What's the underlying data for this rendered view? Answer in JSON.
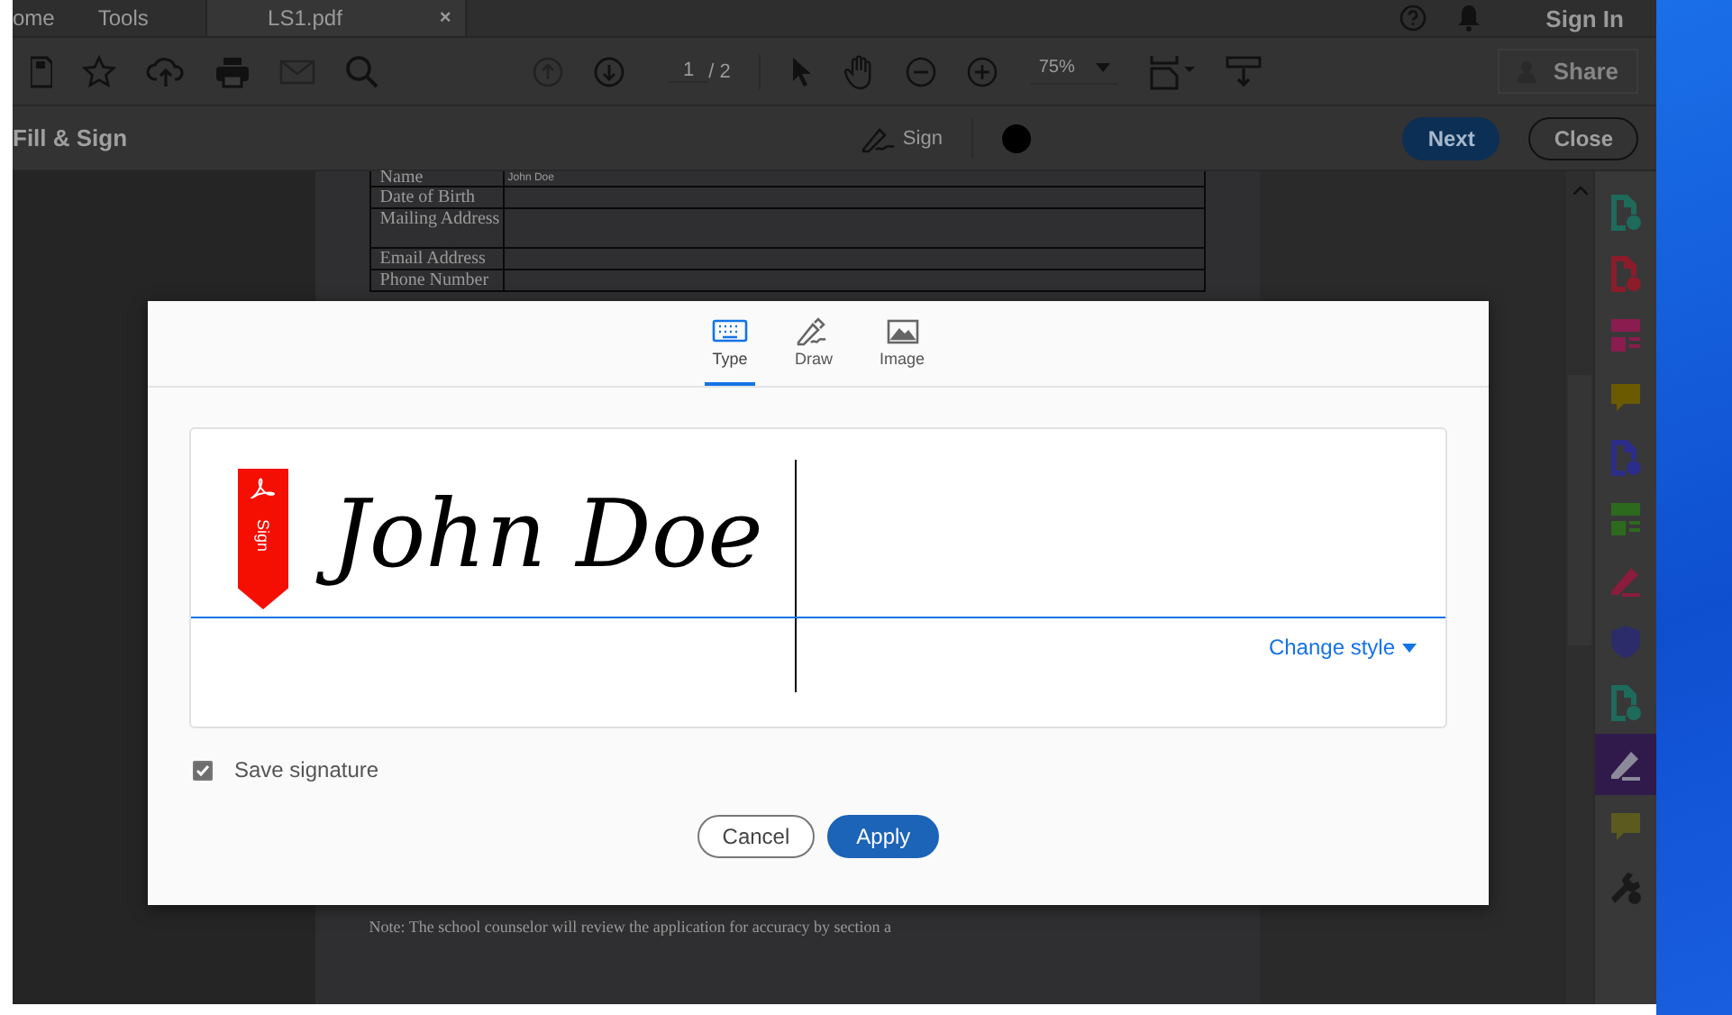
{
  "tabs": [
    {
      "label": "ome",
      "selected": false
    },
    {
      "label": "Tools",
      "selected": false
    },
    {
      "label": "LS1.pdf",
      "selected": true,
      "close": "×"
    }
  ],
  "header_right": {
    "sign_in": "Sign In"
  },
  "toolbar": {
    "page": "1",
    "page_total": "/ 2",
    "zoom": "75%",
    "share": "Share"
  },
  "fill_sign_bar": {
    "title": "Fill & Sign",
    "sign": "Sign",
    "next": "Next",
    "close": "Close"
  },
  "document": {
    "rows": [
      {
        "label": "Name",
        "value": "John Doe",
        "tall": false
      },
      {
        "label": "Date of Birth",
        "tall": false
      },
      {
        "label": "Mailing Address",
        "tall": true
      },
      {
        "label": "Email Address",
        "tall": false
      },
      {
        "label": "Phone Number",
        "tall": false
      }
    ],
    "note": "Note: The school counselor will review the application for accuracy by section a"
  },
  "tools_panel": [
    {
      "kind": "doc",
      "color": "#1e6b5c",
      "selected": false
    },
    {
      "kind": "doc",
      "color": "#8a1c2c",
      "selected": false
    },
    {
      "kind": "layout",
      "color": "#8a1c50",
      "selected": false
    },
    {
      "kind": "comment",
      "color": "#6b5a00",
      "selected": false
    },
    {
      "kind": "doc",
      "color": "#2c2c8a",
      "selected": false
    },
    {
      "kind": "layout",
      "color": "#2c6b1e",
      "selected": false
    },
    {
      "kind": "pen",
      "color": "#8a1c3c",
      "selected": false
    },
    {
      "kind": "shield",
      "color": "#2c2c6b",
      "selected": false
    },
    {
      "kind": "doc",
      "color": "#1e6b5c",
      "selected": false
    },
    {
      "kind": "pen",
      "color": "#8a8a9a",
      "selected": true
    },
    {
      "kind": "comment",
      "color": "#5c5a1e",
      "selected": false
    },
    {
      "kind": "wrench",
      "color": "#1a1a1a",
      "selected": false
    }
  ],
  "dialog": {
    "tabs": [
      {
        "label": "Type",
        "kind": "type",
        "selected": true
      },
      {
        "label": "Draw",
        "kind": "draw",
        "selected": false
      },
      {
        "label": "Image",
        "kind": "image",
        "selected": false
      }
    ],
    "badge": "Sign",
    "signature": "John Doe",
    "change_style": "Change style",
    "save_signature": {
      "label": "Save signature",
      "checked": true
    },
    "buttons": {
      "cancel": "Cancel",
      "apply": "Apply"
    }
  }
}
